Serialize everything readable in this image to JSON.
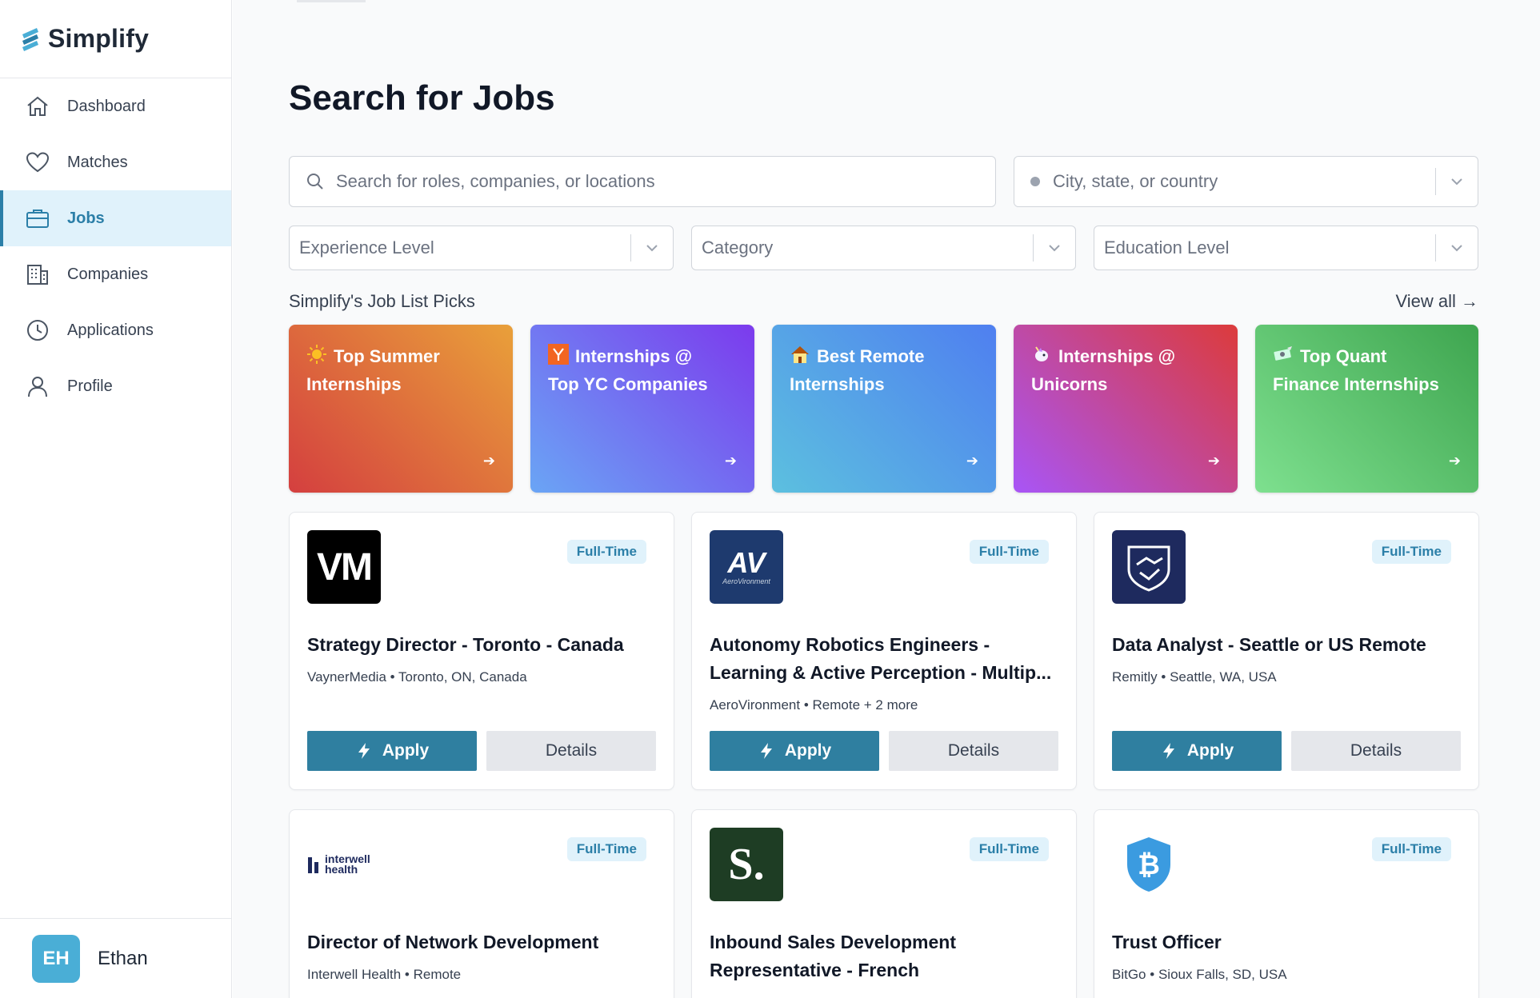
{
  "app": {
    "name": "Simplify"
  },
  "sidebar": {
    "items": [
      {
        "label": "Dashboard",
        "icon": "home-icon"
      },
      {
        "label": "Matches",
        "icon": "heart-icon"
      },
      {
        "label": "Jobs",
        "icon": "briefcase-icon",
        "active": true
      },
      {
        "label": "Companies",
        "icon": "building-icon"
      },
      {
        "label": "Applications",
        "icon": "clock-icon"
      },
      {
        "label": "Profile",
        "icon": "user-icon"
      }
    ],
    "user": {
      "initials": "EH",
      "name": "Ethan"
    }
  },
  "main": {
    "title": "Search for Jobs",
    "search": {
      "placeholder": "Search for roles, companies, or locations"
    },
    "location": {
      "placeholder": "City, state, or country"
    },
    "filters": [
      {
        "label": "Experience Level"
      },
      {
        "label": "Category"
      },
      {
        "label": "Education Level"
      }
    ],
    "picks": {
      "heading": "Simplify's Job List Picks",
      "view_all": "View all →",
      "cards": [
        {
          "line1": "Top Summer",
          "line2": "Internships",
          "icon": "sun-icon",
          "gradient": [
            "#d43f3f",
            "#e9a03a"
          ]
        },
        {
          "line1": "Internships @",
          "line2": "Top YC Companies",
          "icon": "yc-logo-icon",
          "gradient": [
            "#6aa5f5",
            "#7c3aed"
          ]
        },
        {
          "line1": "Best Remote",
          "line2": "Internships",
          "icon": "house-icon",
          "gradient": [
            "#5cc0df",
            "#4f7ff0"
          ]
        },
        {
          "line1": "Internships @",
          "line2": "Unicorns",
          "icon": "unicorn-icon",
          "gradient": [
            "#a855f7",
            "#dc3b3b"
          ]
        },
        {
          "line1": "Top Quant",
          "line2": "Finance Internships",
          "icon": "money-icon",
          "gradient": [
            "#7ee08f",
            "#3ea54f"
          ]
        }
      ]
    },
    "jobs": [
      {
        "badge": "Full-Time",
        "title": "Strategy Director - Toronto - Canada",
        "company": "VaynerMedia",
        "location": "Toronto, ON, Canada",
        "logo": "VM",
        "apply": "Apply",
        "details": "Details"
      },
      {
        "badge": "Full-Time",
        "title": "Autonomy Robotics Engineers - Learning & Active Perception - Multip...",
        "company": "AeroVironment",
        "location": "Remote + 2 more",
        "logo": "AV",
        "logo_sub": "AeroVironment",
        "apply": "Apply",
        "details": "Details"
      },
      {
        "badge": "Full-Time",
        "title": "Data Analyst - Seattle or US Remote",
        "company": "Remitly",
        "location": "Seattle, WA, USA",
        "logo": "remitly-logo",
        "apply": "Apply",
        "details": "Details"
      },
      {
        "badge": "Full-Time",
        "title": "Director of Network Development",
        "company": "Interwell Health",
        "location": "Remote",
        "logo": "interwell health"
      },
      {
        "badge": "Full-Time",
        "title": "Inbound Sales Development Representative - French",
        "company": "",
        "location": "",
        "logo": "S."
      },
      {
        "badge": "Full-Time",
        "title": "Trust Officer",
        "company": "BitGo",
        "location": "Sioux Falls, SD, USA",
        "logo": "bitgo-logo"
      }
    ]
  }
}
